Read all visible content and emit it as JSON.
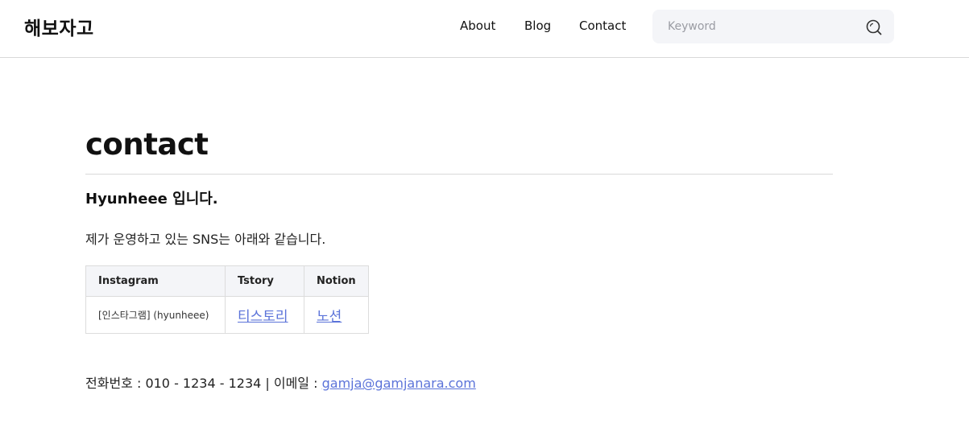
{
  "header": {
    "logo": "해보자고",
    "nav": [
      "About",
      "Blog",
      "Contact"
    ],
    "search": {
      "placeholder": "Keyword",
      "value": ""
    }
  },
  "main": {
    "title": "contact",
    "subtitle": "Hyunheee 입니다.",
    "intro": "제가 운영하고 있는 SNS는 아래와 같습니다.",
    "table": {
      "headers": [
        "Instagram",
        "Tstory",
        "Notion"
      ],
      "rows": [
        [
          "[인스타그램] (hyunheee)",
          "티스토리",
          "노션"
        ]
      ]
    },
    "contact": {
      "prefix": "전화번호 : 010 - 1234 - 1234 | 이메일 : ",
      "email": "gamja@gamjanara.com"
    }
  },
  "colors": {
    "link": "#5b73d9",
    "search_bg": "#f4f5f8",
    "border": "#d9d9d9"
  },
  "icons": {
    "search": "search-icon"
  }
}
